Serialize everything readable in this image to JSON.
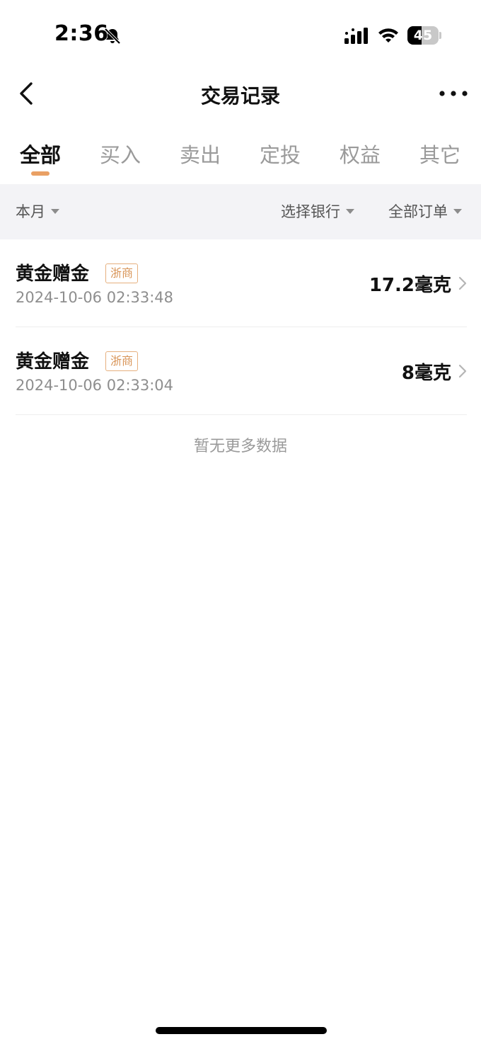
{
  "status_bar": {
    "time": "2:36",
    "battery_level": "45",
    "battery_fraction": 0.45,
    "icons": [
      "bell-slash-icon",
      "cellular-signal-icon",
      "wifi-icon",
      "battery-icon"
    ]
  },
  "nav": {
    "title": "交易记录",
    "back_icon": "chevron-left-icon",
    "more_icon": "more-horizontal-icon"
  },
  "tabs": [
    {
      "label": "全部",
      "active": true
    },
    {
      "label": "买入",
      "active": false
    },
    {
      "label": "卖出",
      "active": false
    },
    {
      "label": "定投",
      "active": false
    },
    {
      "label": "权益",
      "active": false
    },
    {
      "label": "其它",
      "active": false
    }
  ],
  "filters": {
    "period": "本月",
    "bank": "选择银行",
    "orders": "全部订单"
  },
  "records": [
    {
      "title": "黄金赠金",
      "bank_tag": "浙商",
      "time": "2024-10-06 02:33:48",
      "amount": "17.2毫克"
    },
    {
      "title": "黄金赠金",
      "bank_tag": "浙商",
      "time": "2024-10-06 02:33:04",
      "amount": "8毫克"
    }
  ],
  "empty_text": "暂无更多数据",
  "colors": {
    "accent": "#e9a064",
    "tag_text": "#d89457",
    "tag_border": "#e6b07e",
    "filter_bg": "#f3f3f6",
    "muted_text": "#9a9a9a"
  }
}
